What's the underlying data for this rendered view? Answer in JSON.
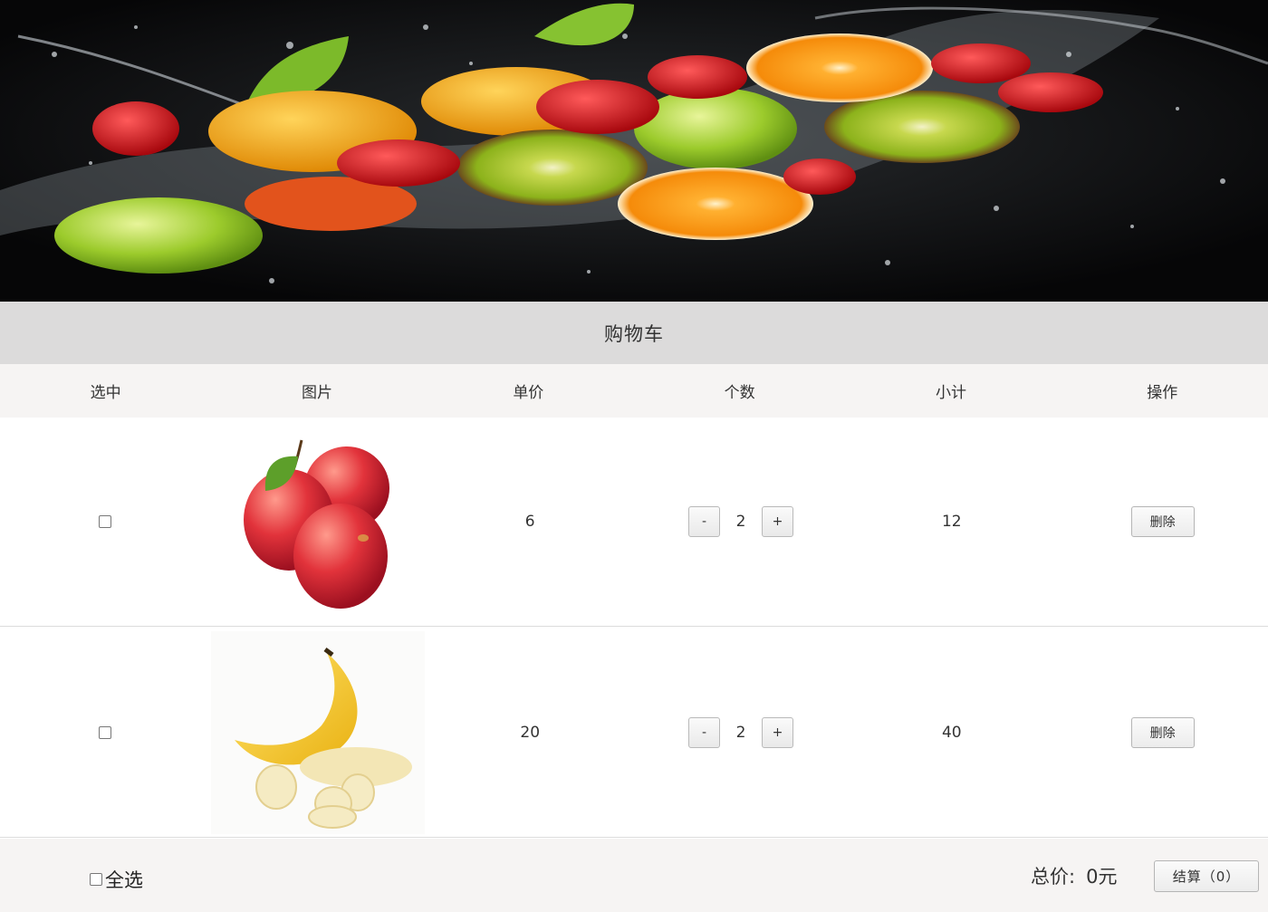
{
  "cart": {
    "title": "购物车",
    "columns": [
      "选中",
      "图片",
      "单价",
      "个数",
      "小计",
      "操作"
    ],
    "items": [
      {
        "name": "apple",
        "checked": false,
        "price": "6",
        "qty": "2",
        "subtotal": "12",
        "minus": "-",
        "plus": "+",
        "delete_label": "删除"
      },
      {
        "name": "banana",
        "checked": false,
        "price": "20",
        "qty": "2",
        "subtotal": "40",
        "minus": "-",
        "plus": "+",
        "delete_label": "删除"
      }
    ],
    "footer": {
      "select_all_label": "全选",
      "total_label": "总价:",
      "total_value": "0元",
      "checkout_label": "结算（0）"
    }
  },
  "banner": {
    "icon": "fruit-splash-image"
  }
}
